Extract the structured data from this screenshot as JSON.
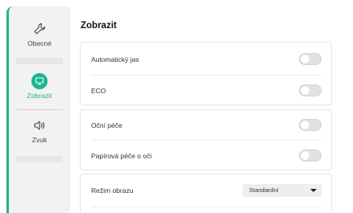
{
  "sidebar": {
    "items": [
      {
        "label": "Obecné",
        "icon": "wrench-icon",
        "active": false
      },
      {
        "label": "Zobrazit",
        "icon": "monitor-icon",
        "active": true
      },
      {
        "label": "Zvuk",
        "icon": "speaker-icon",
        "active": false
      }
    ]
  },
  "main": {
    "title": "Zobrazit",
    "rows": [
      {
        "label": "Automatický jas",
        "control": "toggle",
        "value": "off"
      },
      {
        "label": "ECO",
        "control": "toggle",
        "value": "off"
      },
      {
        "label": "Oční péče",
        "control": "toggle",
        "value": "off"
      },
      {
        "label": "Papírová péče o oči",
        "control": "toggle",
        "value": "off"
      },
      {
        "label": "Režim obrazu",
        "control": "select",
        "value": "Standardní"
      }
    ]
  },
  "colors": {
    "accent": "#18b68a",
    "sidebar_bg": "#f2f2f2",
    "toggle_off": "#e2e2e2"
  }
}
